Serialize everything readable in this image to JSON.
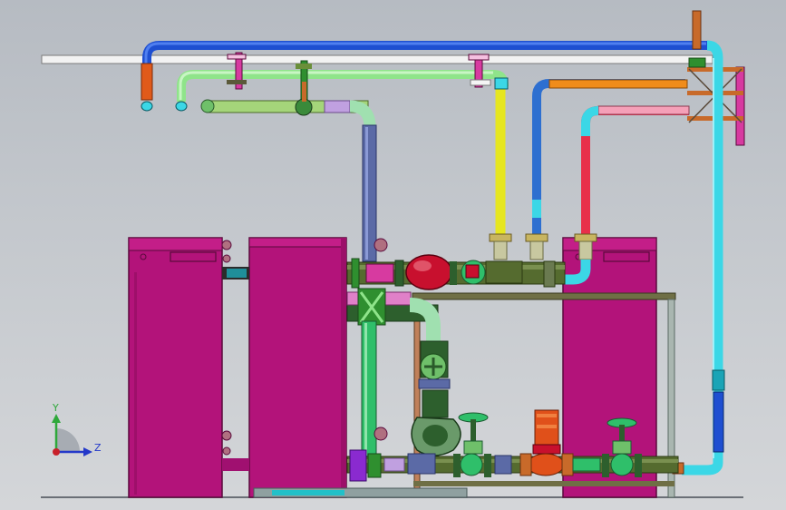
{
  "viewport": {
    "background": "#c2c6cb",
    "axis_triad": {
      "y_label": "Y",
      "z_label": "Z",
      "y_color": "#2ea83a",
      "z_color": "#2338c9",
      "x_color": "#c8202a"
    }
  },
  "colors": {
    "tank": "#b3137a",
    "tank_dark": "#7d0b54",
    "frame": "#6f6f45",
    "frame_post": "#a9b6b0",
    "pipe_top_blue": "#1e4fd1",
    "pipe_white": "#f2f2f2",
    "pipe_green_light": "#8fe48a",
    "pipe_lime": "#a5d57a",
    "pipe_slate": "#5b6aa6",
    "pipe_yellow": "#e6e620",
    "pipe_mid_blue": "#2d6fd0",
    "pipe_orange": "#f08c1a",
    "pipe_pink": "#f06a8f",
    "pipe_red": "#e8304a",
    "pipe_cyan": "#3bd7e6",
    "pipe_cyan_dark": "#1aa4b6",
    "pipe_dark_green": "#2d5f2d",
    "pipe_olive": "#556b2f",
    "pump_red": "#c8102e",
    "pump_orange": "#e0501a",
    "valve_green": "#2fbf6a",
    "valve_dark": "#2b4d38",
    "copper": "#c86a2a",
    "brass": "#c8b560"
  },
  "icons": [
    "tank-icon",
    "pump-icon",
    "gate-valve-icon",
    "flange-icon",
    "pipe-elbow-icon"
  ]
}
